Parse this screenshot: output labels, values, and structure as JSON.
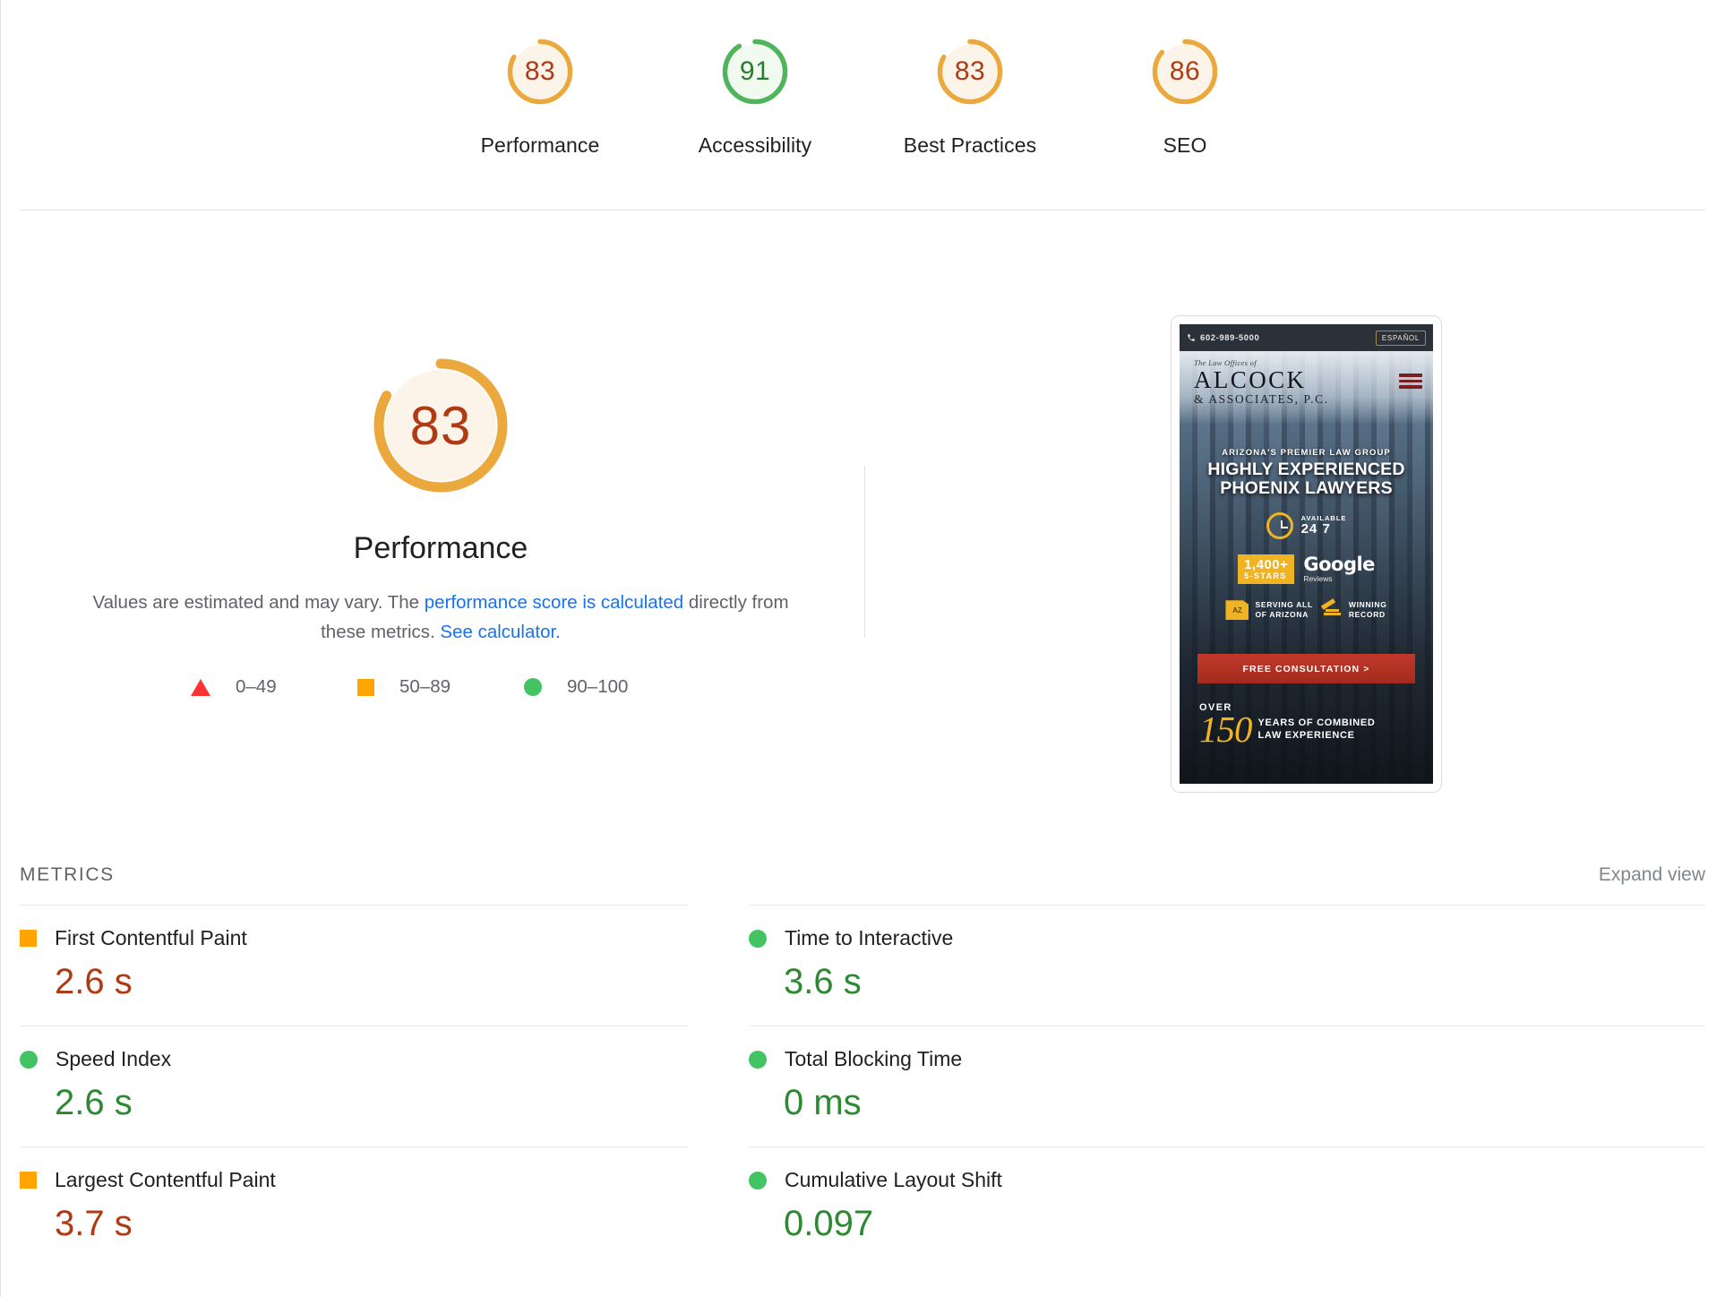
{
  "top_gauges": [
    {
      "score": "83",
      "label": "Performance",
      "rating": "average",
      "arc_color": "#eba83c",
      "fill": "#fdf4e9",
      "text_color": "#b03a14"
    },
    {
      "score": "91",
      "label": "Accessibility",
      "rating": "good",
      "arc_color": "#4fb45a",
      "fill": "#f0faef",
      "text_color": "#2d7a31"
    },
    {
      "score": "83",
      "label": "Best Practices",
      "rating": "average",
      "arc_color": "#eba83c",
      "fill": "#fdf4e9",
      "text_color": "#b03a14"
    },
    {
      "score": "86",
      "label": "SEO",
      "rating": "average",
      "arc_color": "#eba83c",
      "fill": "#fdf4e9",
      "text_color": "#b03a14"
    }
  ],
  "performance": {
    "score": "83",
    "title": "Performance",
    "arc_color": "#eba83c",
    "fill": "#fdf4e9",
    "text_color": "#b03a14",
    "description_part1": "Values are estimated and may vary. The ",
    "description_link1": "performance score is calculated",
    "description_part2": " directly from these metrics. ",
    "description_link2": "See calculator."
  },
  "legend": [
    {
      "symbol": "triangle-icon",
      "range": "0–49",
      "color": "#ff3333"
    },
    {
      "symbol": "square-icon",
      "range": "50–89",
      "color": "#ffa400"
    },
    {
      "symbol": "circle-icon",
      "range": "90–100",
      "color": "#43c463"
    }
  ],
  "thumbnail": {
    "phone": "602-989-5000",
    "language_button": "ESPAÑOL",
    "logo_small": "The Law Offices of",
    "logo_main": "ALCOCK",
    "logo_sub": "& ASSOCIATES, P.C.",
    "kicker": "ARIZONA'S PREMIER LAW GROUP",
    "headline_line1": "HIGHLY EXPERIENCED",
    "headline_line2": "PHOENIX LAWYERS",
    "available_label": "AVAILABLE",
    "available_value": "24 7",
    "reviews_count": "1,400+",
    "reviews_stars": "5-STARS",
    "google_text": "Google",
    "google_sub": "Reviews",
    "az_badge": "AZ",
    "serving_line1": "SERVING ALL",
    "serving_line2": "OF ARIZONA",
    "winning_line1": "WINNING",
    "winning_line2": "RECORD",
    "cta": "FREE CONSULTATION >",
    "over_label": "OVER",
    "years_number": "150",
    "years_line1": "YEARS OF COMBINED",
    "years_line2": "LAW EXPERIENCE"
  },
  "metrics_section": {
    "title": "METRICS",
    "expand_view": "Expand view"
  },
  "metrics": [
    {
      "name": "First Contentful Paint",
      "value": "2.6 s",
      "icon": "square-icon",
      "icon_color": "#ffa400",
      "value_color": "#b03a14"
    },
    {
      "name": "Time to Interactive",
      "value": "3.6 s",
      "icon": "circle-icon",
      "icon_color": "#43c463",
      "value_color": "#2d8a32"
    },
    {
      "name": "Speed Index",
      "value": "2.6 s",
      "icon": "circle-icon",
      "icon_color": "#43c463",
      "value_color": "#2d8a32"
    },
    {
      "name": "Total Blocking Time",
      "value": "0 ms",
      "icon": "circle-icon",
      "icon_color": "#43c463",
      "value_color": "#2d8a32"
    },
    {
      "name": "Largest Contentful Paint",
      "value": "3.7 s",
      "icon": "square-icon",
      "icon_color": "#ffa400",
      "value_color": "#b03a14"
    },
    {
      "name": "Cumulative Layout Shift",
      "value": "0.097",
      "icon": "circle-icon",
      "icon_color": "#43c463",
      "value_color": "#2d8a32"
    }
  ]
}
